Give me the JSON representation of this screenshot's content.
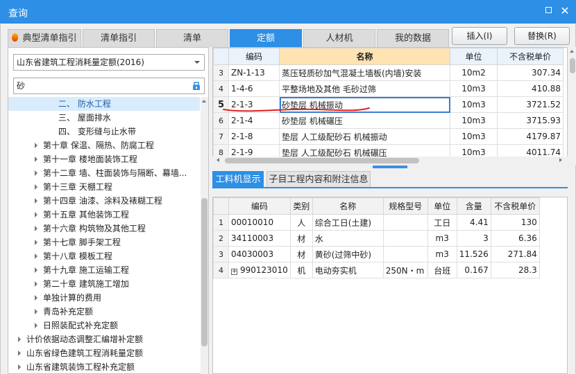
{
  "window": {
    "title": "查询"
  },
  "tabs": [
    {
      "label": "典型清单指引",
      "active": false,
      "has_icon": true
    },
    {
      "label": "清单指引",
      "active": false
    },
    {
      "label": "清单",
      "active": false
    },
    {
      "label": "定额",
      "active": true
    },
    {
      "label": "人材机",
      "active": false
    },
    {
      "label": "我的数据",
      "active": false
    }
  ],
  "actions": {
    "insert": "插入(I)",
    "replace": "替换(R)"
  },
  "left": {
    "quota_select": "山东省建筑工程消耗量定额(2016)",
    "search_value": "砂",
    "tree": [
      {
        "label": "二、 防水工程",
        "level": 3,
        "expandable": false,
        "selected": true
      },
      {
        "label": "三、 屋面排水",
        "level": 3,
        "expandable": false
      },
      {
        "label": "四、 变形缝与止水带",
        "level": 3,
        "expandable": false
      },
      {
        "label": "第十章 保温、隔热、防腐工程",
        "level": 2,
        "expandable": true
      },
      {
        "label": "第十一章 楼地面装饰工程",
        "level": 2,
        "expandable": true
      },
      {
        "label": "第十二章 墙、柱面装饰与隔断、幕墙...",
        "level": 2,
        "expandable": true
      },
      {
        "label": "第十三章 天棚工程",
        "level": 2,
        "expandable": true
      },
      {
        "label": "第十四章 油漆、涂料及裱糊工程",
        "level": 2,
        "expandable": true
      },
      {
        "label": "第十五章 其他装饰工程",
        "level": 2,
        "expandable": true
      },
      {
        "label": "第十六章 构筑物及其他工程",
        "level": 2,
        "expandable": true
      },
      {
        "label": "第十七章 脚手架工程",
        "level": 2,
        "expandable": true
      },
      {
        "label": "第十八章 模板工程",
        "level": 2,
        "expandable": true
      },
      {
        "label": "第十九章 施工运输工程",
        "level": 2,
        "expandable": true
      },
      {
        "label": "第二十章 建筑施工增加",
        "level": 2,
        "expandable": true
      },
      {
        "label": "单独计算的费用",
        "level": 2,
        "expandable": true
      },
      {
        "label": "青岛补充定额",
        "level": 2,
        "expandable": true
      },
      {
        "label": "日照装配式补充定额",
        "level": 2,
        "expandable": true
      },
      {
        "label": "计价依据动态调整汇编增补定额",
        "level": 1,
        "expandable": true
      },
      {
        "label": "山东省绿色建筑工程消耗量定额",
        "level": 1,
        "expandable": true
      },
      {
        "label": "山东省建筑装饰工程补充定额",
        "level": 1,
        "expandable": true
      }
    ]
  },
  "quota_table": {
    "headers": {
      "code": "编码",
      "name": "名称",
      "unit": "单位",
      "price": "不含税单价"
    },
    "rows": [
      {
        "no": "3",
        "code": "ZN-1-13",
        "name": "蒸压轻质砂加气混凝土墙板(内墙)安装",
        "unit": "10m2",
        "price": "307.34"
      },
      {
        "no": "4",
        "code": "1-4-6",
        "name": "平整场地及其他 毛砂过筛",
        "unit": "10m3",
        "price": "410.88"
      },
      {
        "no": "5",
        "code": "2-1-3",
        "name": "砂垫层 机械振动",
        "unit": "10m3",
        "price": "3721.52",
        "current": true
      },
      {
        "no": "6",
        "code": "2-1-4",
        "name": "砂垫层 机械碾压",
        "unit": "10m3",
        "price": "3715.93"
      },
      {
        "no": "7",
        "code": "2-1-8",
        "name": "垫层 人工级配砂石 机械振动",
        "unit": "10m3",
        "price": "4179.87"
      },
      {
        "no": "8",
        "code": "2-1-9",
        "name": "垫层 人工级配砂石 机械碾压",
        "unit": "10m3",
        "price": "4011.74"
      }
    ]
  },
  "lower_tabs": [
    {
      "label": "工料机显示",
      "active": true
    },
    {
      "label": "子目工程内容和附注信息",
      "active": false
    }
  ],
  "material_table": {
    "headers": {
      "code": "编码",
      "type": "类别",
      "name": "名称",
      "spec": "规格型号",
      "unit": "单位",
      "qty": "含量",
      "price": "不含税单价"
    },
    "rows": [
      {
        "no": "1",
        "code": "00010010",
        "type": "人",
        "name": "综合工日(土建)",
        "spec": "",
        "unit": "工日",
        "qty": "4.41",
        "price": "130"
      },
      {
        "no": "2",
        "code": "34110003",
        "type": "材",
        "name": "水",
        "spec": "",
        "unit": "m3",
        "qty": "3",
        "price": "6.36"
      },
      {
        "no": "3",
        "code": "04030003",
        "type": "材",
        "name": "黄砂(过筛中砂)",
        "spec": "",
        "unit": "m3",
        "qty": "11.526",
        "price": "271.84"
      },
      {
        "no": "4",
        "code": "990123010",
        "type": "机",
        "name": "电动夯实机",
        "spec": "250N・m",
        "unit": "台班",
        "qty": "0.167",
        "price": "28.3",
        "expandable": true
      }
    ]
  },
  "colors": {
    "accent": "#2d8fe5",
    "highlight_header": "#ffe3b3",
    "annotation": "#e02020"
  }
}
